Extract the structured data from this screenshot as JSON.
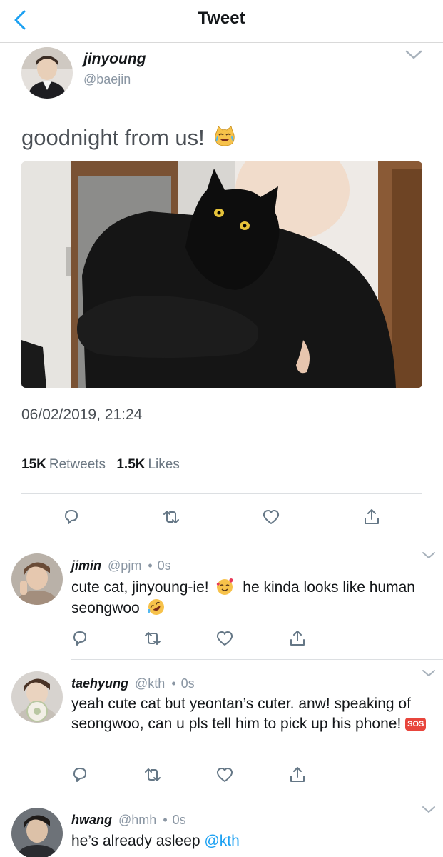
{
  "header": {
    "title": "Tweet"
  },
  "tweet": {
    "display_name": "jinyoung",
    "handle": "@baejin",
    "text": "goodnight from us!",
    "emoji": "joy-cat-emoji",
    "timestamp": "06/02/2019, 21:24",
    "retweets": "15K",
    "retweets_label": "Retweets",
    "likes": "1.5K",
    "likes_label": "Likes"
  },
  "replies": [
    {
      "name": "jimin",
      "handle": "@pjm",
      "time": "0s",
      "text_parts": [
        "cute cat, jinyoung-ie!",
        "he kinda looks like human seongwoo"
      ],
      "emoji": [
        "smiling-face-with-hearts-emoji",
        "rofl-emoji"
      ]
    },
    {
      "name": "taehyung",
      "handle": "@kth",
      "time": "0s",
      "text_parts": [
        "yeah cute cat but yeontan’s cuter. anw! speaking of seongwoo, can u pls tell him to pick up his phone!"
      ],
      "badge": "SOS"
    },
    {
      "name": "hwang",
      "handle": "@hmh",
      "time": "0s",
      "text_parts": [
        "he’s already asleep"
      ],
      "mention": "@kth"
    }
  ],
  "colors": {
    "accent": "#1da1f2",
    "text": "#14171a",
    "secondary": "#8a96a3",
    "divider": "#dcdfe2",
    "icon": "#657786"
  },
  "icons": [
    "back-chevron-icon",
    "chevron-down-icon",
    "reply-icon",
    "retweet-icon",
    "like-icon",
    "share-icon"
  ]
}
